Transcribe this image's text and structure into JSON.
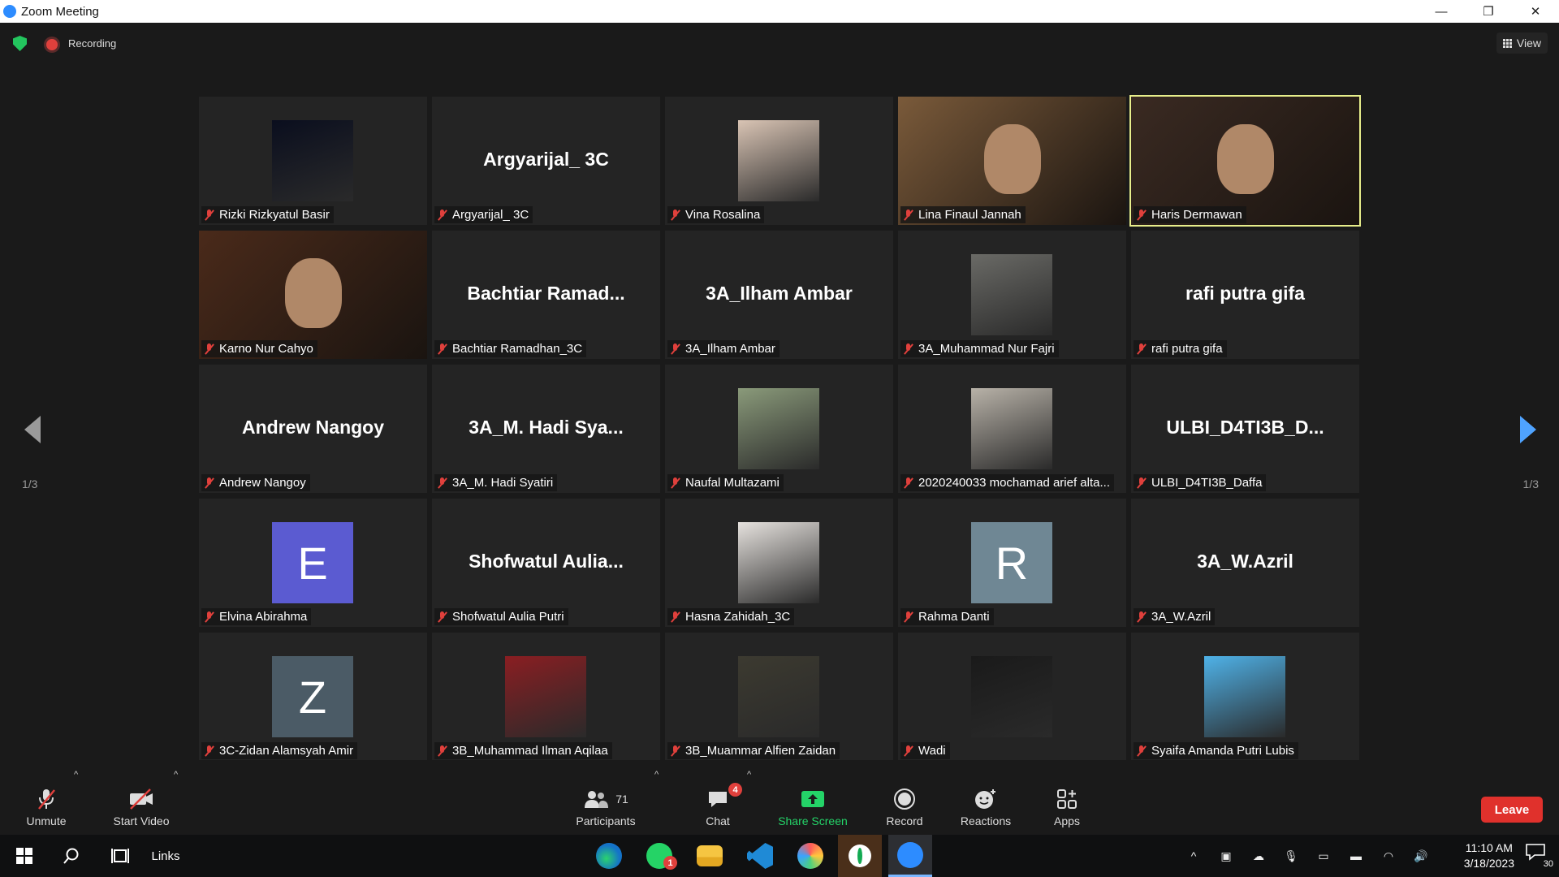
{
  "window": {
    "title": "Zoom Meeting",
    "minimize": "—",
    "restore": "❐",
    "close": "✕"
  },
  "topbar": {
    "recording_label": "Recording",
    "view_label": "View"
  },
  "pager": {
    "left_page": "1/3",
    "right_page": "1/3"
  },
  "tiles": [
    {
      "name": "Rizki Rizkyatul Basir",
      "display": "",
      "kind": "image",
      "color": "#0a0e1e"
    },
    {
      "name": "Argyarijal_ 3C",
      "display": "Argyarijal_ 3C",
      "kind": "name",
      "color": ""
    },
    {
      "name": "Vina Rosalina",
      "display": "",
      "kind": "image",
      "color": "#d9c4b4"
    },
    {
      "name": "Lina Finaul Jannah",
      "display": "",
      "kind": "video",
      "color": "#7a5a3a"
    },
    {
      "name": "Haris Dermawan",
      "display": "",
      "kind": "video",
      "color": "#3a2a22"
    },
    {
      "name": "Karno Nur Cahyo",
      "display": "",
      "kind": "video",
      "color": "#4a2a1a"
    },
    {
      "name": "Bachtiar Ramadhan_3C",
      "display": "Bachtiar  Ramad...",
      "kind": "name",
      "color": ""
    },
    {
      "name": "3A_Ilham Ambar",
      "display": "3A_Ilham Ambar",
      "kind": "name",
      "color": ""
    },
    {
      "name": "3A_Muhammad Nur Fajri",
      "display": "",
      "kind": "image",
      "color": "#6a6a66"
    },
    {
      "name": "rafi putra gifa",
      "display": "rafi putra gifa",
      "kind": "name",
      "color": ""
    },
    {
      "name": "Andrew Nangoy",
      "display": "Andrew Nangoy",
      "kind": "name",
      "color": ""
    },
    {
      "name": "3A_M. Hadi Syatiri",
      "display": "3A_M. Hadi Sya...",
      "kind": "name",
      "color": ""
    },
    {
      "name": "Naufal Multazami",
      "display": "",
      "kind": "image",
      "color": "#8a9a7a"
    },
    {
      "name": "2020240033 mochamad arief alta...",
      "display": "",
      "kind": "image",
      "color": "#b8b2a8"
    },
    {
      "name": "ULBI_D4TI3B_Daffa",
      "display": "ULBI_D4TI3B_D...",
      "kind": "name",
      "color": ""
    },
    {
      "name": "Elvina Abirahma",
      "display": "E",
      "kind": "letter",
      "color": "#5b5bd1"
    },
    {
      "name": "Shofwatul Aulia Putri",
      "display": "Shofwatul  Aulia...",
      "kind": "name",
      "color": ""
    },
    {
      "name": "Hasna Zahidah_3C",
      "display": "",
      "kind": "image",
      "color": "#e6e2de"
    },
    {
      "name": "Rahma Danti",
      "display": "R",
      "kind": "letter",
      "color": "#6f8794"
    },
    {
      "name": "3A_W.Azril",
      "display": "3A_W.Azril",
      "kind": "name",
      "color": ""
    },
    {
      "name": "3C-Zidan Alamsyah Amir",
      "display": "Z",
      "kind": "letter",
      "color": "#4b5b66"
    },
    {
      "name": "3B_Muhammad Ilman Aqilaa",
      "display": "",
      "kind": "image",
      "color": "#8a1e22"
    },
    {
      "name": "3B_Muammar Alfien Zaidan",
      "display": "",
      "kind": "image",
      "color": "#3c3a30"
    },
    {
      "name": "Wadi",
      "display": "",
      "kind": "image",
      "color": "#1a1a1a"
    },
    {
      "name": "Syaifa Amanda Putri Lubis",
      "display": "",
      "kind": "image",
      "color": "#4fb2e8"
    }
  ],
  "toolbar": {
    "unmute": "Unmute",
    "start_video": "Start Video",
    "participants": "Participants",
    "participants_count": "71",
    "chat": "Chat",
    "chat_badge": "4",
    "share_screen": "Share Screen",
    "record": "Record",
    "reactions": "Reactions",
    "apps": "Apps",
    "leave": "Leave"
  },
  "taskbar": {
    "links": "Links",
    "time": "11:10 AM",
    "date": "3/18/2023",
    "notifications": "30",
    "whatsapp_badge": "1"
  }
}
